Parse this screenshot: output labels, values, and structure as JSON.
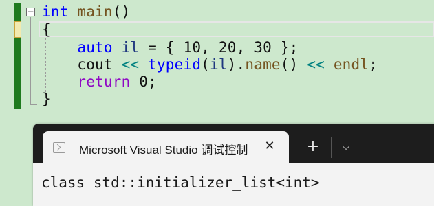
{
  "editor": {
    "fold_glyph": "−",
    "lines": [
      [
        {
          "t": "int",
          "c": "kw"
        },
        {
          "t": " "
        },
        {
          "t": "main",
          "c": "fn"
        },
        {
          "t": "()"
        }
      ],
      [
        {
          "t": "{"
        }
      ],
      [
        {
          "t": "    "
        },
        {
          "t": "auto",
          "c": "kw"
        },
        {
          "t": " "
        },
        {
          "t": "il",
          "c": "var"
        },
        {
          "t": " = { "
        },
        {
          "t": "10",
          "c": "num"
        },
        {
          "t": ", "
        },
        {
          "t": "20",
          "c": "num"
        },
        {
          "t": ", "
        },
        {
          "t": "30",
          "c": "num"
        },
        {
          "t": " };"
        }
      ],
      [
        {
          "t": "    cout "
        },
        {
          "t": "<<",
          "c": "op"
        },
        {
          "t": " "
        },
        {
          "t": "typeid",
          "c": "kw"
        },
        {
          "t": "("
        },
        {
          "t": "il",
          "c": "var"
        },
        {
          "t": ")."
        },
        {
          "t": "name",
          "c": "fn"
        },
        {
          "t": "() "
        },
        {
          "t": "<<",
          "c": "op"
        },
        {
          "t": " "
        },
        {
          "t": "endl",
          "c": "fn"
        },
        {
          "t": ";"
        }
      ],
      [
        {
          "t": "    "
        },
        {
          "t": "return",
          "c": "cl"
        },
        {
          "t": " 0;"
        }
      ],
      [
        {
          "t": "}"
        }
      ]
    ]
  },
  "terminal": {
    "tab_title": "Microsoft Visual Studio 调试控制台",
    "close_glyph": "✕",
    "new_tab_glyph": "+",
    "dropdown_glyph": "⌵",
    "output": "class std::initializer_list<int>"
  }
}
